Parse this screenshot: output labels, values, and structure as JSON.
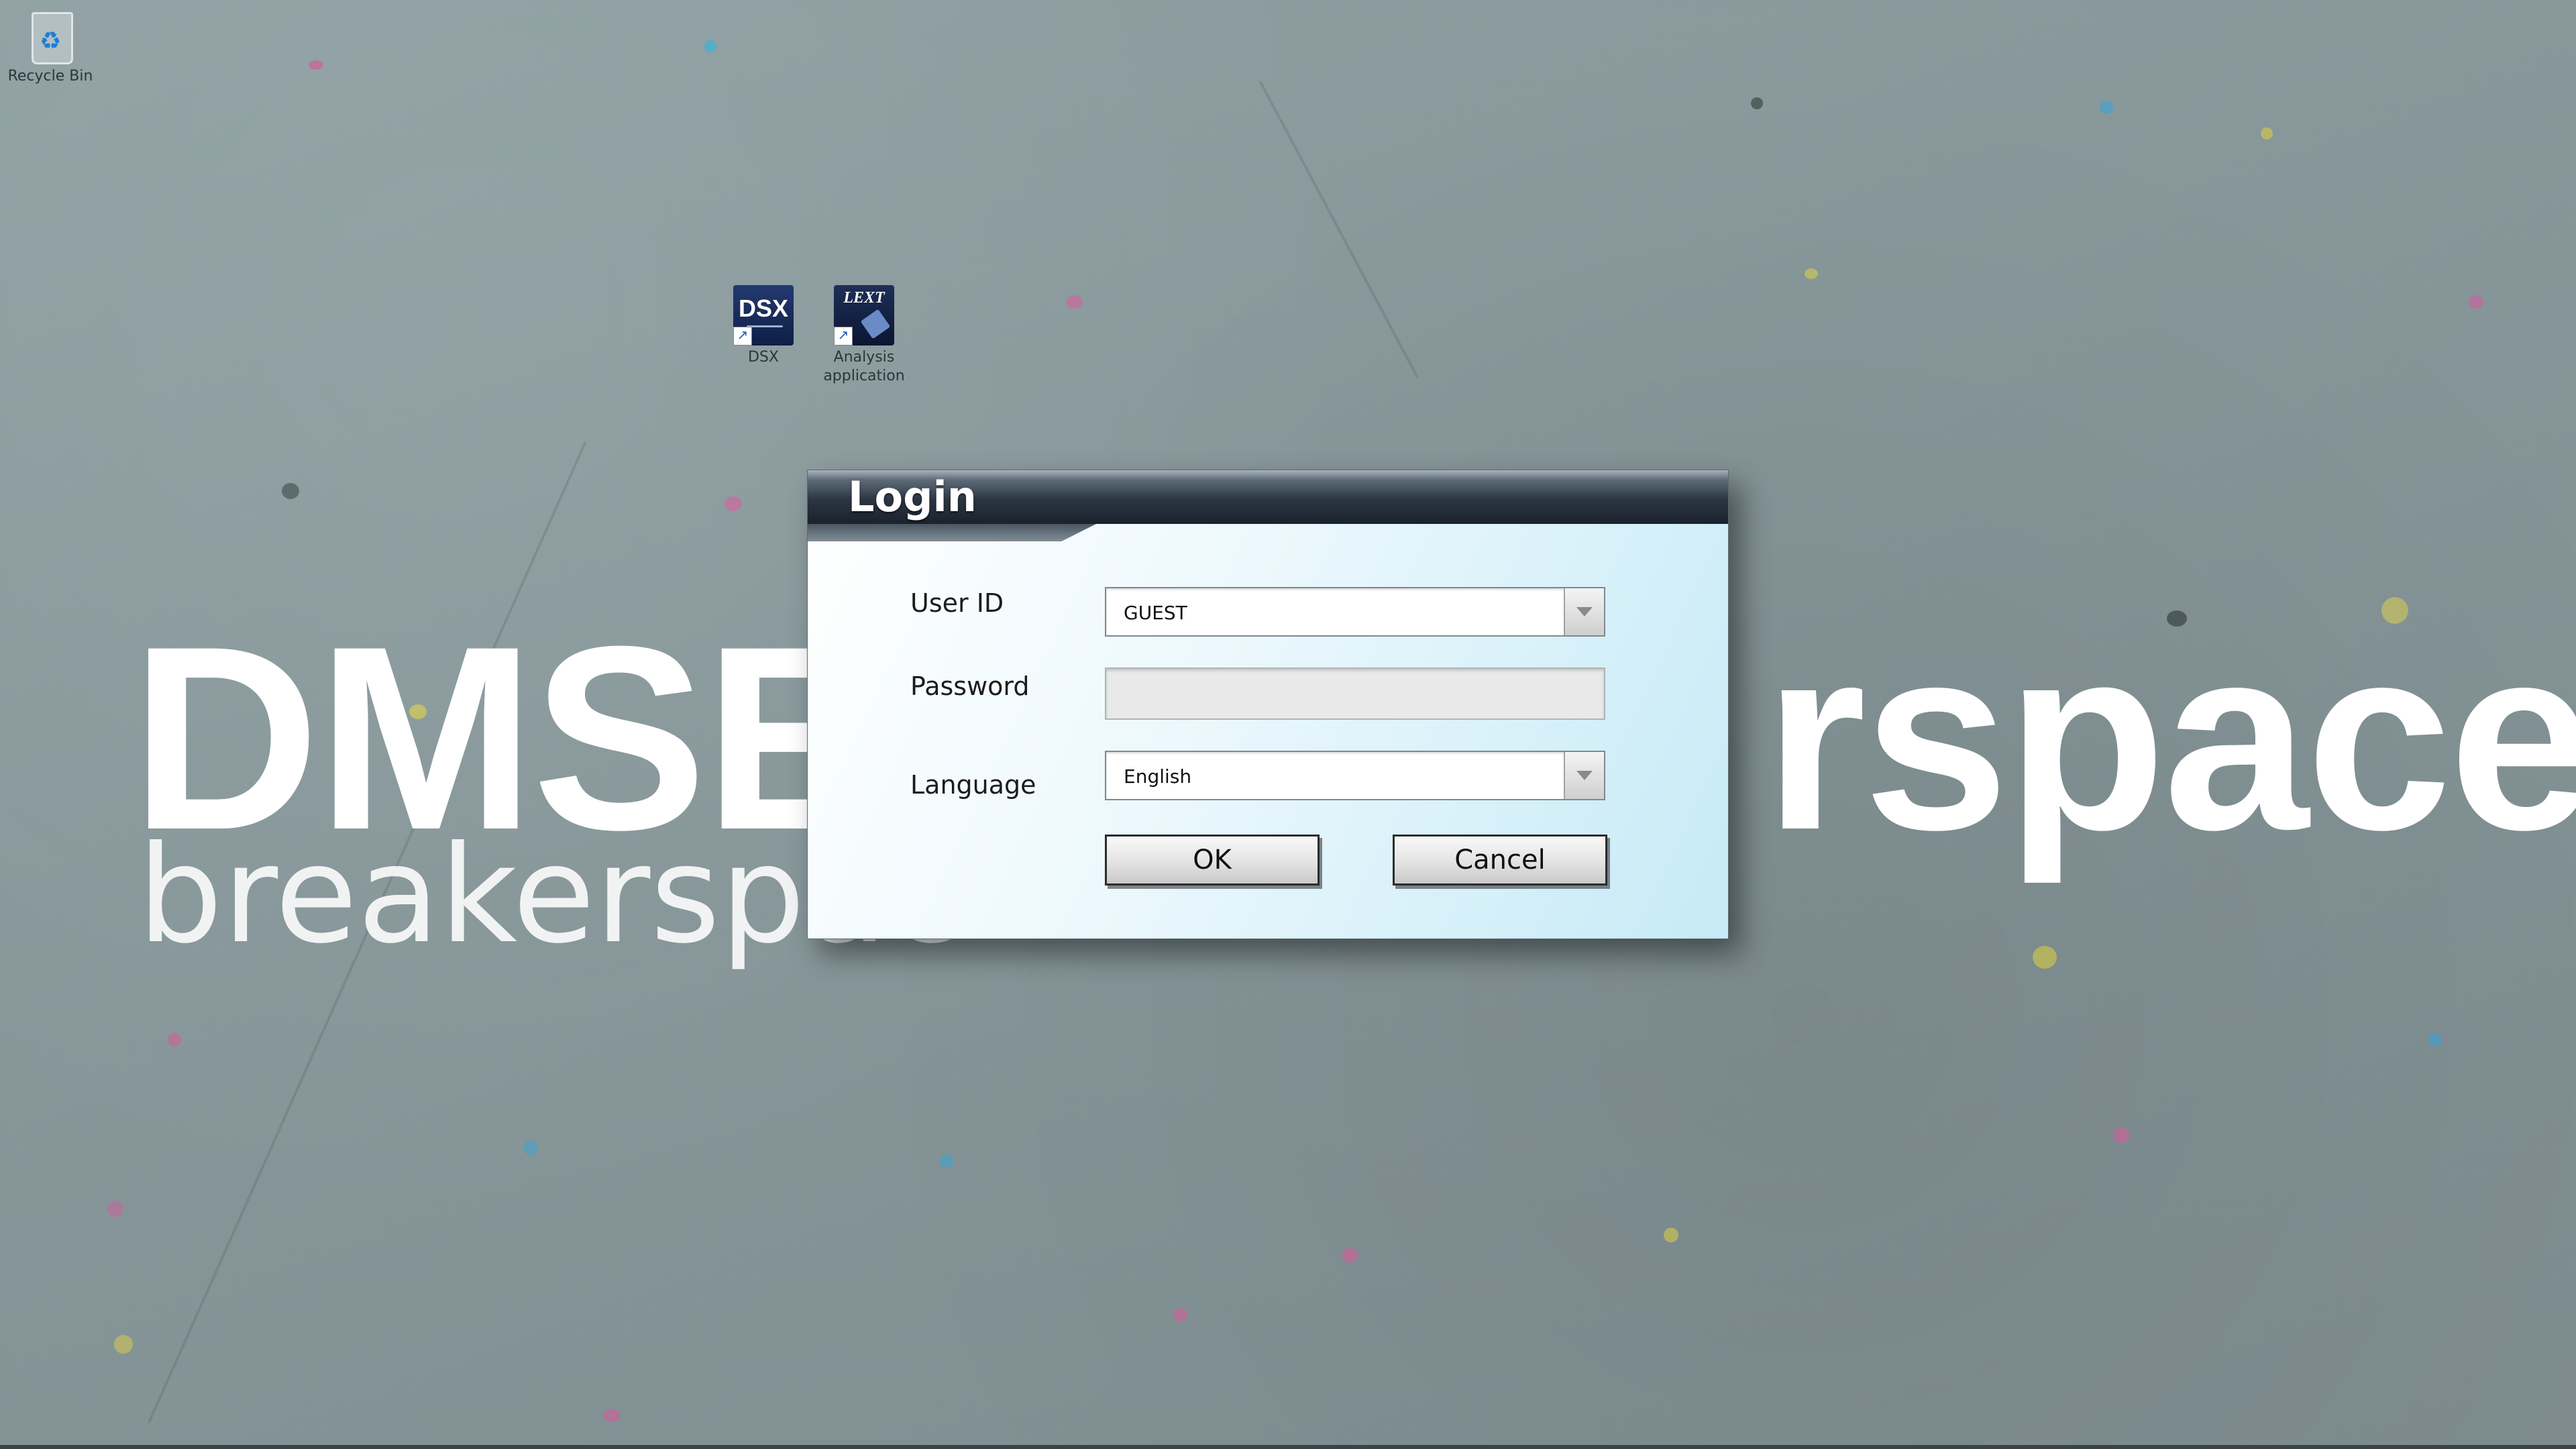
{
  "desktop": {
    "icons": [
      {
        "label": "Recycle Bin"
      },
      {
        "label": "DSX",
        "glyph": "DSX"
      },
      {
        "label": "Analysis application",
        "glyph": "LEXT"
      }
    ],
    "wallpaper": {
      "title_left": "DMSE",
      "title_right": "rspace",
      "subtitle": "breakerspac"
    }
  },
  "dialog": {
    "title": "Login",
    "user_id_label": "User ID",
    "user_id_value": "GUEST",
    "password_label": "Password",
    "password_value": "",
    "language_label": "Language",
    "language_value": "English",
    "ok_label": "OK",
    "cancel_label": "Cancel"
  },
  "colors": {
    "dialog_body": "#c6eaf6",
    "titlebar": "#1a222c",
    "wallpaper": "#869699"
  }
}
